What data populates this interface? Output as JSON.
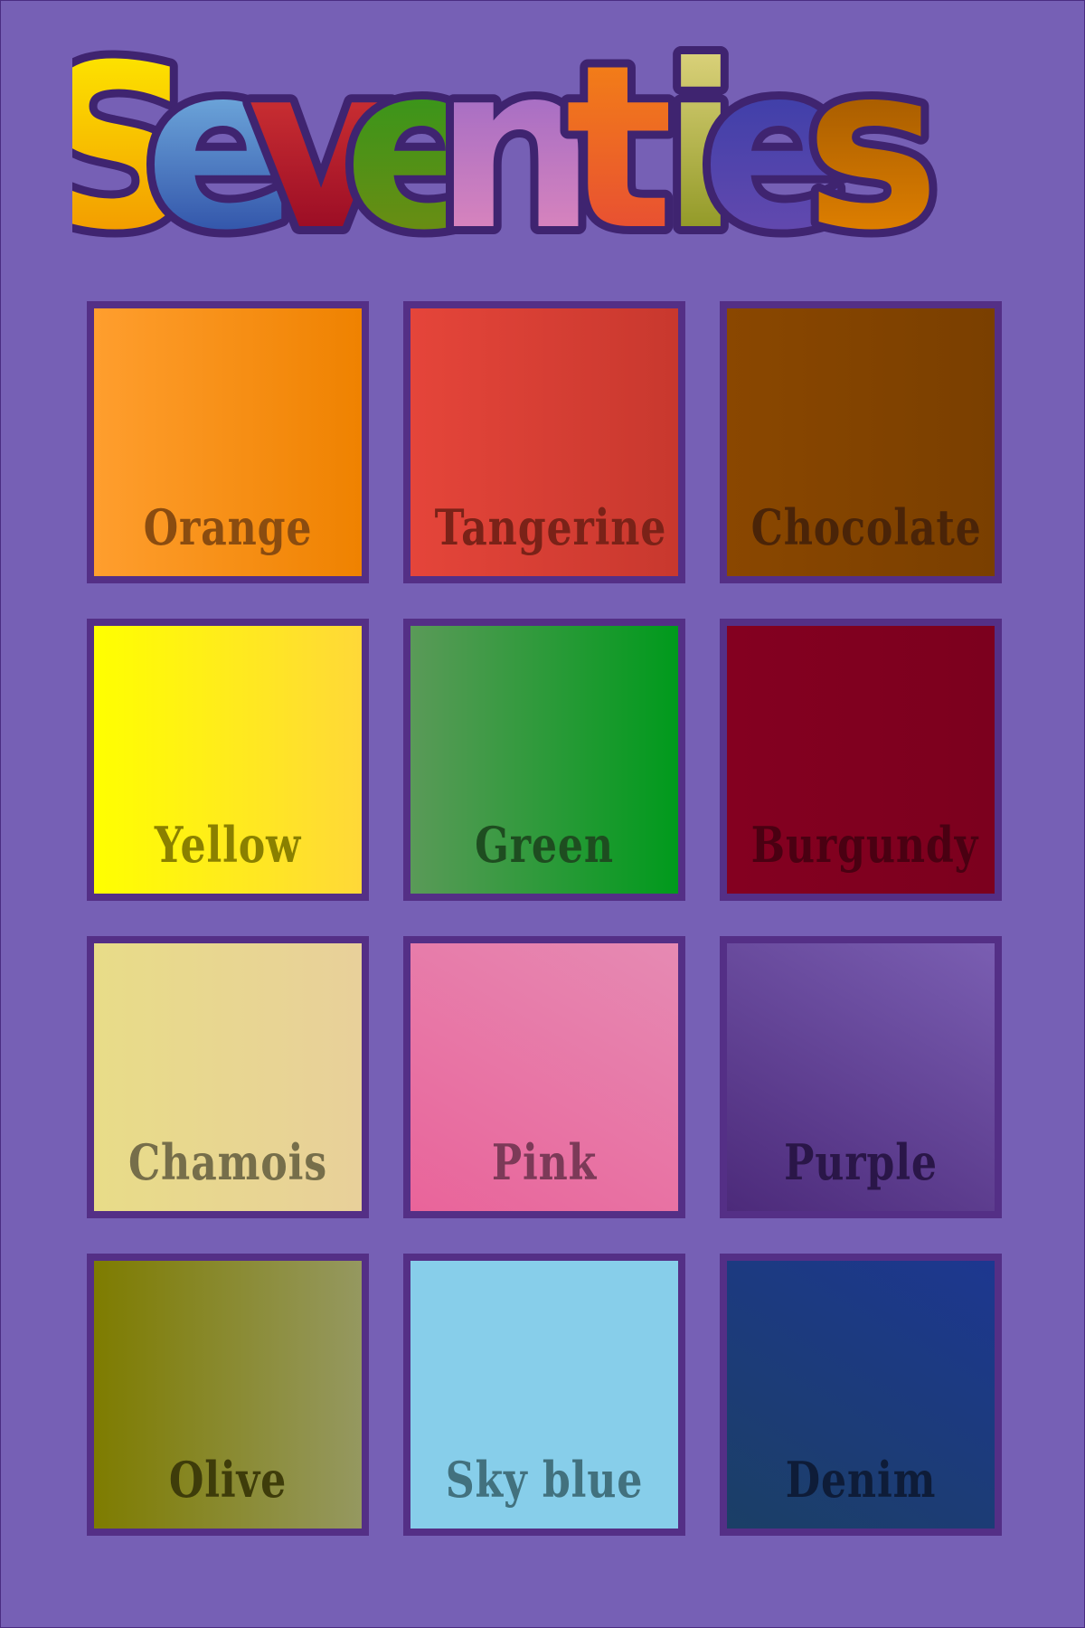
{
  "title": {
    "text": "Seventies",
    "letters": [
      {
        "char": "S",
        "top": "#fff200",
        "bottom": "#f08a00"
      },
      {
        "char": "e",
        "top": "#8dd3f5",
        "bottom": "#1f3a9a"
      },
      {
        "char": "v",
        "top": "#e5433a",
        "bottom": "#8a0020"
      },
      {
        "char": "e",
        "top": "#1f9a1f",
        "bottom": "#7a8a10"
      },
      {
        "char": "n",
        "top": "#8a62c8",
        "bottom": "#e98bbb"
      },
      {
        "char": "t",
        "top": "#f58a10",
        "bottom": "#e5433a"
      },
      {
        "char": "i",
        "top": "#e8dc8a",
        "bottom": "#7e8a10"
      },
      {
        "char": "e",
        "top": "#2c3aa6",
        "bottom": "#6e4cb0"
      },
      {
        "char": "s",
        "top": "#8a4a00",
        "bottom": "#f08a00"
      }
    ]
  },
  "swatches": [
    {
      "label": "Orange",
      "from": "#ff9e2e",
      "to": "#ef8200",
      "angle": "90deg",
      "text_color": "#8a4c10"
    },
    {
      "label": "Tangerine",
      "from": "#e5453a",
      "to": "#c8382e",
      "angle": "90deg",
      "text_color": "#7a2218"
    },
    {
      "label": "Chocolate",
      "from": "#8a4700",
      "to": "#7a3f00",
      "angle": "90deg",
      "text_color": "#4a2408"
    },
    {
      "label": "Yellow",
      "from": "#ffff00",
      "to": "#ffd838",
      "angle": "90deg",
      "text_color": "#8a8000"
    },
    {
      "label": "Green",
      "from": "#5a9a58",
      "to": "#009a1c",
      "angle": "90deg",
      "text_color": "#1e4d20"
    },
    {
      "label": "Burgundy",
      "from": "#840020",
      "to": "#7c001e",
      "angle": "90deg",
      "text_color": "#4a0012"
    },
    {
      "label": "Chamois",
      "from": "#e8dc88",
      "to": "#e8d09a",
      "angle": "90deg",
      "text_color": "#766e4a"
    },
    {
      "label": "Pink",
      "from": "#e9649a",
      "to": "#e68ab3",
      "angle": "30deg",
      "text_color": "#7c3a58"
    },
    {
      "label": "Purple",
      "from": "#4c2a7a",
      "to": "#7a5eb2",
      "angle": "30deg",
      "text_color": "#2a1648"
    },
    {
      "label": "Olive",
      "from": "#7e7c00",
      "to": "#959860",
      "angle": "90deg",
      "text_color": "#3e3c0a"
    },
    {
      "label": "Sky blue",
      "from": "#87ceea",
      "to": "#87ceea",
      "angle": "90deg",
      "text_color": "#42717e"
    },
    {
      "label": "Denim",
      "from": "#1b3f66",
      "to": "#1d3790",
      "angle": "30deg",
      "text_color": "#0e1c38"
    }
  ]
}
